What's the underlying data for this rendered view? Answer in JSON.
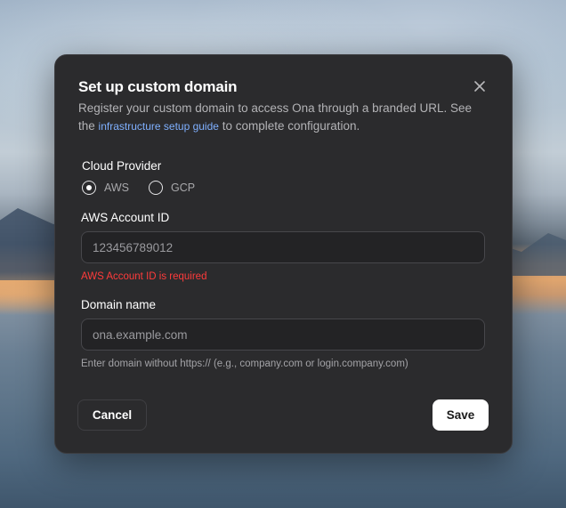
{
  "dialog": {
    "title": "Set up custom domain",
    "description_before": "Register your custom domain to access Ona through a branded URL. See the ",
    "description_link": "infrastructure setup guide",
    "description_after": " to complete configuration.",
    "close_icon": "close-icon"
  },
  "cloud_provider": {
    "label": "Cloud Provider",
    "options": [
      {
        "label": "AWS",
        "selected": true
      },
      {
        "label": "GCP",
        "selected": false
      }
    ]
  },
  "aws_account_id": {
    "label": "AWS Account ID",
    "placeholder": "123456789012",
    "value": "",
    "error": "AWS Account ID is required"
  },
  "domain_name": {
    "label": "Domain name",
    "placeholder": "ona.example.com",
    "value": "",
    "hint": "Enter domain without https:// (e.g., company.com or login.company.com)"
  },
  "actions": {
    "cancel_label": "Cancel",
    "save_label": "Save"
  },
  "colors": {
    "dialog_bg": "#2b2b2d",
    "link": "#7fb0ff",
    "error": "#ff3b3b",
    "primary_button_bg": "#ffffff"
  }
}
